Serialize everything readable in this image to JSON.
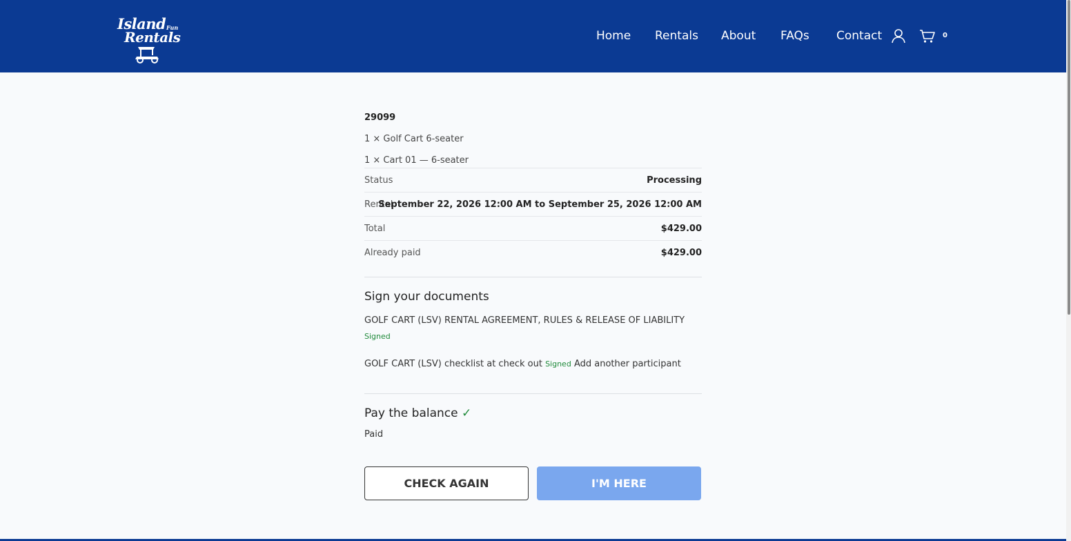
{
  "header": {
    "logo": {
      "line1": "Island",
      "line1_small": "Fun",
      "line2": "Rentals"
    },
    "nav": [
      {
        "label": "Home"
      },
      {
        "label": "Rentals"
      },
      {
        "label": "About"
      },
      {
        "label": "FAQs"
      },
      {
        "label": "Contact"
      }
    ],
    "icons": {
      "account": "user-icon",
      "cart": "cart-icon"
    },
    "cart_count": "0"
  },
  "order": {
    "number": "29099",
    "items": [
      "1 × Golf Cart 6-seater",
      "1 × Cart 01 — 6-seater"
    ],
    "details": [
      {
        "label": "Status",
        "value": "Processing"
      },
      {
        "label": "Rental",
        "value": "September 22, 2026 12:00 AM to September 25, 2026 12:00 AM"
      },
      {
        "label": "Total",
        "value": "$429.00"
      },
      {
        "label": "Already paid",
        "value": "$429.00"
      }
    ]
  },
  "documents": {
    "title": "Sign your documents",
    "items": [
      {
        "name": "GOLF CART (LSV) RENTAL AGREEMENT, RULES & RELEASE OF LIABILITY",
        "status": "Signed"
      },
      {
        "name": "GOLF CART (LSV) checklist at check out",
        "status": "Signed",
        "extra_link": "Add another participant"
      }
    ]
  },
  "payment": {
    "title": "Pay the balance",
    "check": "✓",
    "status": "Paid"
  },
  "actions": {
    "check_again": "CHECK AGAIN",
    "im_here": "I'M HERE"
  },
  "colors": {
    "header_bg": "#0b3a93",
    "signed_green": "#1f8a3a",
    "primary_button": "#7aa7ee"
  }
}
